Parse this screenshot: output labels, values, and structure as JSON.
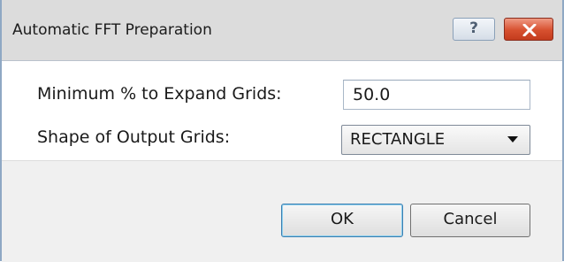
{
  "window": {
    "title": "Automatic FFT Preparation",
    "help_label": "?"
  },
  "form": {
    "min_expand_label": "Minimum % to Expand Grids:",
    "min_expand_value": "50.0",
    "shape_label": "Shape of Output Grids:",
    "shape_selected": "RECTANGLE"
  },
  "buttons": {
    "ok_label": "OK",
    "cancel_label": "Cancel"
  },
  "icons": {
    "help": "help-icon",
    "close": "close-icon",
    "dropdown": "dropdown-arrow-icon"
  },
  "colors": {
    "titlebar": "#dcdcdc",
    "close_button": "#d7502f",
    "footer": "#f0f0f0",
    "ok_border": "#3c7fb1"
  }
}
